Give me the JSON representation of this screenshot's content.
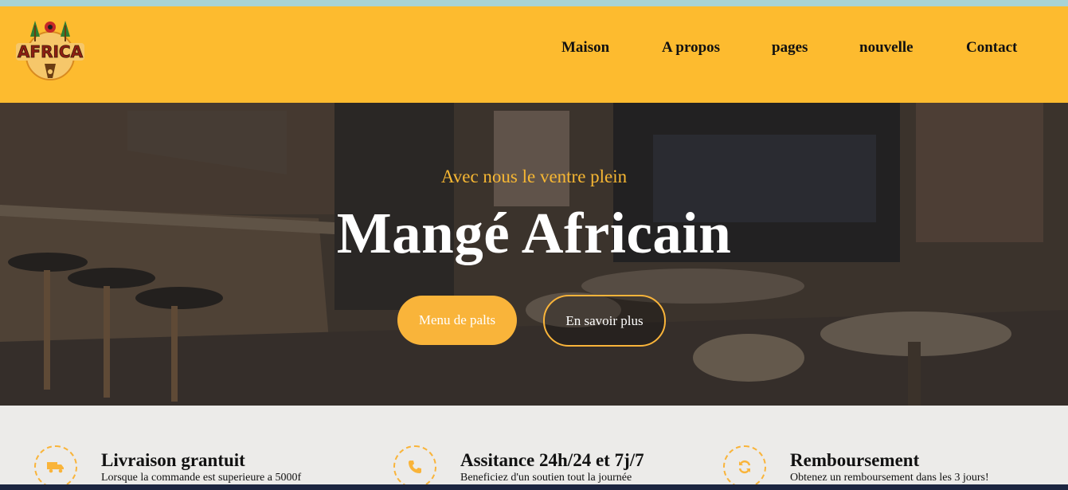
{
  "brand": {
    "logo_text": "AFRICA"
  },
  "nav": {
    "items": [
      {
        "label": "Maison"
      },
      {
        "label": "A propos"
      },
      {
        "label": "pages"
      },
      {
        "label": "nouvelle"
      },
      {
        "label": "Contact"
      }
    ]
  },
  "hero": {
    "tagline": "Avec nous le ventre plein",
    "title": "Mangé Africain",
    "primary_button": "Menu de palts",
    "secondary_button": "En savoir plus"
  },
  "features": [
    {
      "icon": "truck-icon",
      "title": "Livraison grantuit",
      "description": "Lorsque la commande est superieure a 5000f"
    },
    {
      "icon": "phone-icon",
      "title": "Assitance 24h/24 et 7j/7",
      "description": "Beneficiez d'un soutien tout la journée"
    },
    {
      "icon": "refresh-icon",
      "title": "Remboursement",
      "description": "Obtenez un remboursement dans les 3 jours!"
    }
  ],
  "colors": {
    "accent": "#f9b43a",
    "navbar": "#fdbb2f",
    "text": "#111111",
    "hero_overlay": "#2b241f"
  }
}
